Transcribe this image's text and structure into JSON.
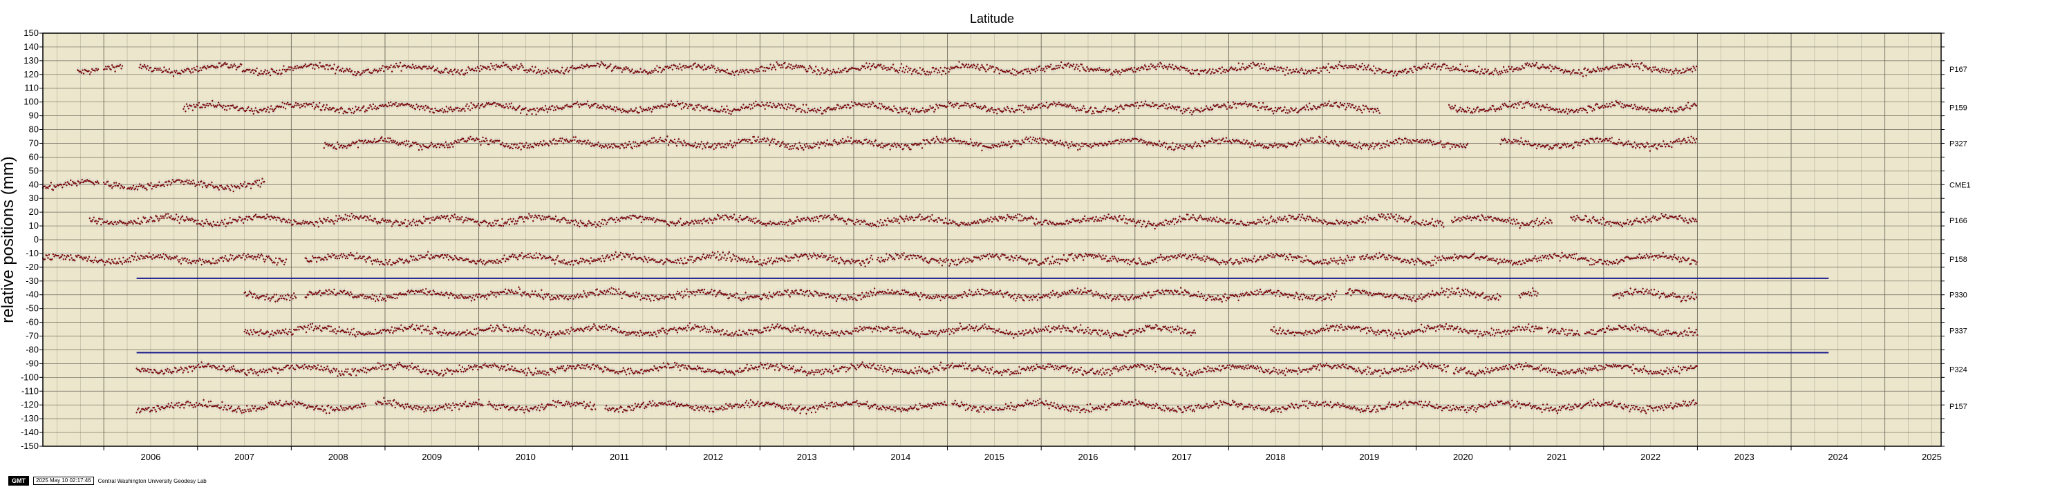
{
  "chart_data": {
    "type": "scatter",
    "title": "Latitude",
    "ylabel": "relative positions (mm)",
    "xlabel": "",
    "xlim": [
      2005.35,
      2025.6
    ],
    "ylim": [
      -150,
      150
    ],
    "y_tick_step": 10,
    "x_tick_labels": [
      "2006",
      "2007",
      "2008",
      "2009",
      "2010",
      "2011",
      "2012",
      "2013",
      "2014",
      "2015",
      "2016",
      "2017",
      "2018",
      "2019",
      "2020",
      "2021",
      "2022",
      "2023",
      "2024",
      "2025"
    ],
    "grid": true,
    "plot_background": "#ece6cc",
    "marker_color": "#7a0a0a",
    "error_color": "#c8c8c8",
    "line_color": "#1a1a8c",
    "series": [
      {
        "name": "P167",
        "offset": 124,
        "segments": [
          [
            2005.72,
            2005.95
          ],
          [
            2006.0,
            2006.2
          ],
          [
            2006.38,
            2023.0
          ]
        ]
      },
      {
        "name": "P159",
        "offset": 96,
        "segments": [
          [
            2006.85,
            2019.62
          ],
          [
            2020.35,
            2023.0
          ]
        ]
      },
      {
        "name": "P327",
        "offset": 70,
        "segments": [
          [
            2008.35,
            2020.55
          ],
          [
            2020.9,
            2023.0
          ]
        ]
      },
      {
        "name": "CME1",
        "offset": 40,
        "segments": [
          [
            2005.35,
            2005.95
          ],
          [
            2006.0,
            2006.22
          ],
          [
            2006.25,
            2007.72
          ]
        ]
      },
      {
        "name": "P166",
        "offset": 14,
        "segments": [
          [
            2005.85,
            2020.3
          ],
          [
            2020.38,
            2021.45
          ],
          [
            2021.65,
            2023.0
          ]
        ]
      },
      {
        "name": "P158",
        "offset": -14,
        "segments": [
          [
            2005.35,
            2007.95
          ],
          [
            2008.15,
            2014.2
          ],
          [
            2014.25,
            2019.35
          ],
          [
            2019.4,
            2023.0
          ]
        ]
      },
      {
        "name": "P330",
        "offset": -40,
        "segments": [
          [
            2007.5,
            2008.05
          ],
          [
            2008.15,
            2019.15
          ],
          [
            2019.25,
            2020.9
          ],
          [
            2021.1,
            2021.3
          ],
          [
            2022.1,
            2023.0
          ]
        ]
      },
      {
        "name": "P337",
        "offset": -66,
        "segments": [
          [
            2007.5,
            2017.65
          ],
          [
            2018.45,
            2021.35
          ],
          [
            2021.4,
            2021.75
          ],
          [
            2021.8,
            2023.0
          ]
        ]
      },
      {
        "name": "P324",
        "offset": -94,
        "segments": [
          [
            2006.35,
            2020.35
          ],
          [
            2020.4,
            2023.0
          ]
        ]
      },
      {
        "name": "P157",
        "offset": -121,
        "segments": [
          [
            2006.35,
            2008.8
          ],
          [
            2008.9,
            2010.05
          ],
          [
            2010.1,
            2011.25
          ],
          [
            2011.35,
            2015.0
          ],
          [
            2015.05,
            2023.0
          ]
        ]
      }
    ],
    "reference_lines": [
      {
        "y": -28,
        "x_start": 2006.35,
        "x_end": 2024.4
      },
      {
        "y": -82,
        "x_start": 2006.35,
        "x_end": 2024.4
      }
    ]
  },
  "footer": {
    "logo": "GMT",
    "timestamp": "2025 May 10 02:17:46",
    "credit": "Central Washington University Geodesy Lab"
  }
}
